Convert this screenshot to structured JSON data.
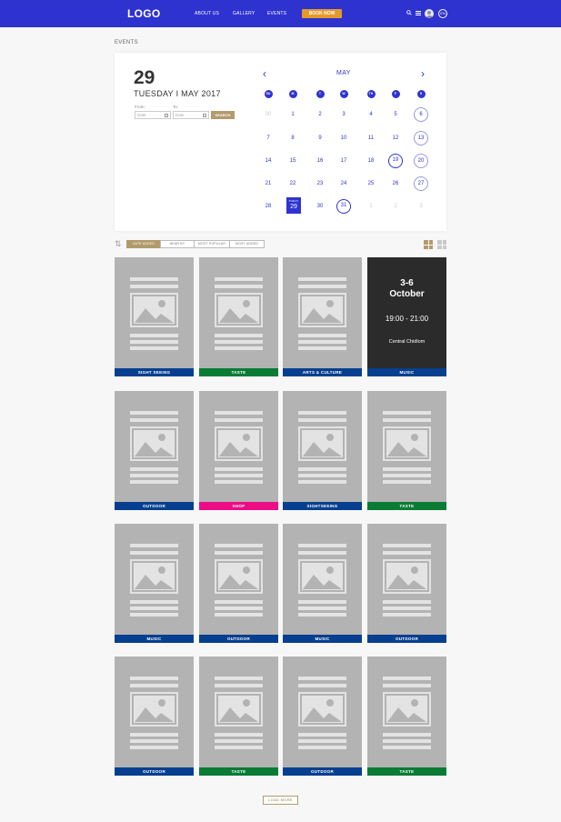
{
  "nav": {
    "logo": "LOGO",
    "links": [
      "ABOUT US",
      "GALLERY",
      "EVENTS"
    ],
    "book_label": "BOOK NOW",
    "lang": "EN",
    "brand_color": "#2e33d0",
    "book_color": "#e49a2a"
  },
  "page_label": "EVENTS",
  "calendar": {
    "selected_day": "29",
    "selected_date_text": "TUESDAY  I  MAY 2017",
    "from_label": "From:",
    "to_label": "To:",
    "from_placeholder": "Date",
    "to_placeholder": "Date",
    "search_label": "SEARCH",
    "month": "MAY",
    "weekdays": [
      "SU",
      "M",
      "T",
      "W",
      "TH",
      "F",
      "S"
    ],
    "today_label": "TODAY",
    "rows": [
      [
        "30",
        "1",
        "2",
        "3",
        "4",
        "5",
        "6"
      ],
      [
        "7",
        "8",
        "9",
        "10",
        "11",
        "12",
        "13"
      ],
      [
        "14",
        "15",
        "16",
        "17",
        "18",
        "19",
        "20"
      ],
      [
        "21",
        "22",
        "23",
        "24",
        "25",
        "26",
        "27"
      ],
      [
        "28",
        "29",
        "30",
        "31",
        "1",
        "2",
        "3"
      ]
    ]
  },
  "sort": {
    "options": [
      "DATE ADDED",
      "NEAR BY",
      "MOST POPULAR",
      "MOST ADDED"
    ],
    "active": "DATE ADDED"
  },
  "featured_card": {
    "dates": "3-6",
    "month": "October",
    "time": "19:00 - 21:00",
    "location": "Central Chidlom",
    "category": "MUSIC"
  },
  "cards": [
    {
      "category": "SIGHT SEEING",
      "color": "#063f8f"
    },
    {
      "category": "TASTE",
      "color": "#0a7b35"
    },
    {
      "category": "ARTS & CULTURE",
      "color": "#063f8f"
    },
    {
      "category": "OUTDOOR",
      "color": "#063f8f"
    },
    {
      "category": "SHOP",
      "color": "#ec0c86"
    },
    {
      "category": "SIGHTSEEING",
      "color": "#063f8f"
    },
    {
      "category": "TASTE",
      "color": "#0a7b35"
    },
    {
      "category": "MUSIC",
      "color": "#063f8f"
    },
    {
      "category": "OUTDOOR",
      "color": "#063f8f"
    },
    {
      "category": "MUSIC",
      "color": "#063f8f"
    },
    {
      "category": "OUTDOOR",
      "color": "#063f8f"
    },
    {
      "category": "OUTDOOR",
      "color": "#063f8f"
    },
    {
      "category": "TASTE",
      "color": "#0a7b35"
    },
    {
      "category": "OUTDOOR",
      "color": "#063f8f"
    },
    {
      "category": "TASTE",
      "color": "#0a7b35"
    }
  ],
  "load_more_label": "LOAD MORE"
}
